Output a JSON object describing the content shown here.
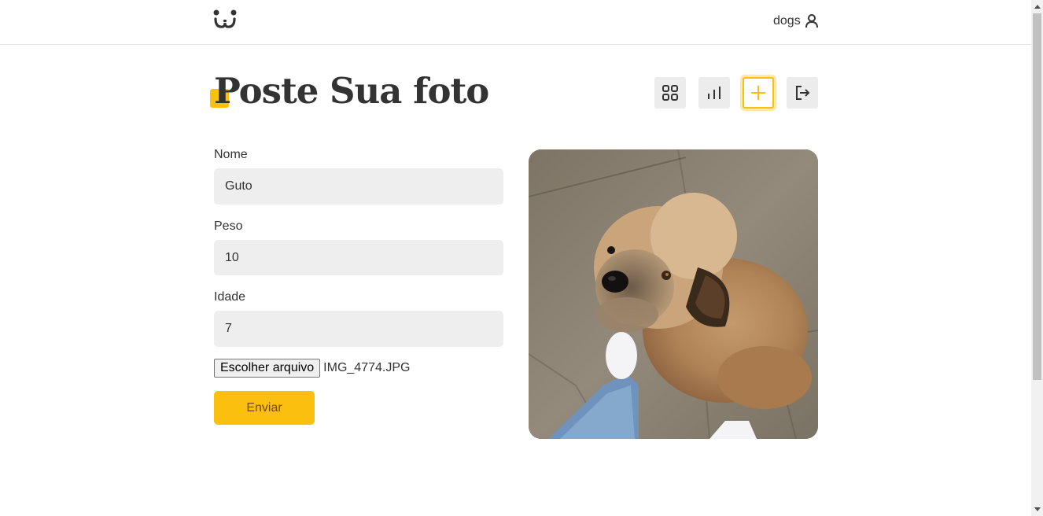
{
  "header": {
    "logo_icon": "dog-face-icon",
    "username": "dogs",
    "user_icon": "user-icon"
  },
  "page": {
    "title": "Poste Sua foto"
  },
  "nav": {
    "buttons": [
      {
        "icon": "grid-icon",
        "active": false
      },
      {
        "icon": "bar-chart-icon",
        "active": false
      },
      {
        "icon": "plus-icon",
        "active": true
      },
      {
        "icon": "logout-icon",
        "active": false
      }
    ],
    "accent_color": "#fbbf10"
  },
  "form": {
    "nome": {
      "label": "Nome",
      "value": "Guto"
    },
    "peso": {
      "label": "Peso",
      "value": "10"
    },
    "idade": {
      "label": "Idade",
      "value": "7"
    },
    "file": {
      "button_label": "Escolher arquivo",
      "file_name": "IMG_4774.JPG"
    },
    "submit_label": "Enviar"
  },
  "preview": {
    "subject": "dog-photo"
  }
}
